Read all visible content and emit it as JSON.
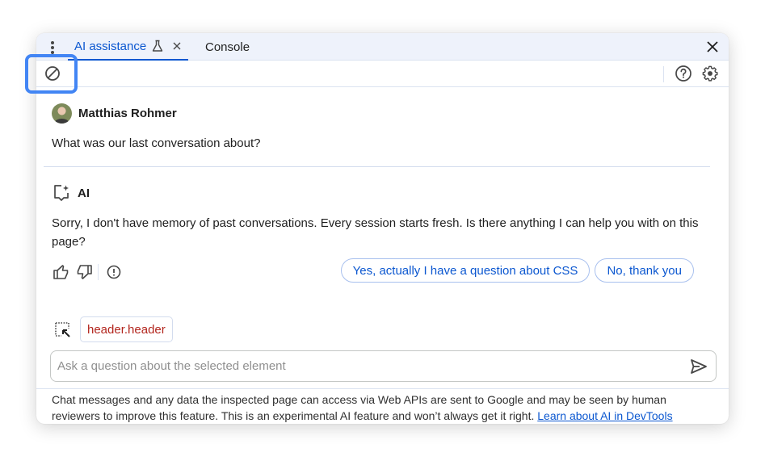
{
  "tabs": [
    {
      "label": "AI assistance",
      "active": true,
      "experimental_icon": "flask-icon",
      "closable": true
    },
    {
      "label": "Console",
      "active": false
    }
  ],
  "toolbar": {
    "clear_icon": "clear-conversation-icon",
    "help_icon": "help-icon",
    "settings_icon": "settings-icon"
  },
  "conversation": {
    "user": {
      "name": "Matthias Rohmer",
      "message": "What was our last conversation about?"
    },
    "ai": {
      "name": "AI",
      "message": "Sorry, I don't have memory of past conversations. Every session starts fresh. Is there anything I can help you with on this page?"
    },
    "suggestions": [
      "Yes, actually I have a question about CSS",
      "No, thank you"
    ]
  },
  "context": {
    "selected_element": "header.header"
  },
  "input": {
    "value": "",
    "placeholder": "Ask a question about the selected element"
  },
  "footer": {
    "disclaimer": "Chat messages and any data the inspected page can access via Web APIs are sent to Google and may be seen by human reviewers to improve this feature. This is an experimental AI feature and won’t always get it right. ",
    "link_label": "Learn about AI in DevTools"
  },
  "colors": {
    "accent": "#0b57d0",
    "highlight": "#4285f4",
    "selector_text": "#b3261e"
  }
}
